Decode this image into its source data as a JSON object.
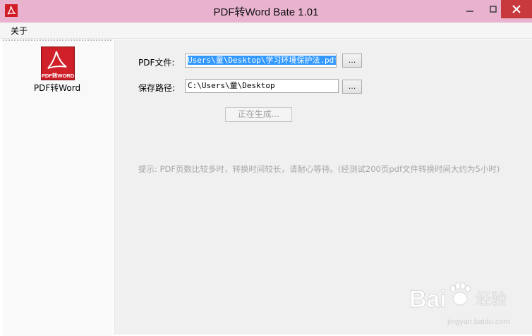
{
  "window": {
    "title": "PDF转Word Bate 1.01"
  },
  "menu": {
    "items": [
      {
        "label": "关于"
      }
    ]
  },
  "sidebar": {
    "items": [
      {
        "label": "PDF转Word",
        "icon": "pdf-to-word-icon",
        "icon_text": "PDF转WORD"
      }
    ]
  },
  "form": {
    "pdf_label": "PDF文件:",
    "pdf_value": "Users\\童\\Desktop\\学习环境保护法.pdf",
    "save_label": "保存路径:",
    "save_value": "C:\\Users\\童\\Desktop",
    "browse_label": "...",
    "generate_label": "正在生成..."
  },
  "hint": "提示: PDF页数比较多时，转换时间较长，请耐心等待。(经测试200页pdf文件转换时间大约为5小时)",
  "watermark": {
    "brand": "Bai",
    "brand_tail": "经验",
    "url": "jingyan.baidu.com"
  },
  "colors": {
    "titlebar": "#e9b3cf",
    "close": "#c7393c",
    "icon_red": "#c81d25",
    "selection": "#3399ff"
  }
}
